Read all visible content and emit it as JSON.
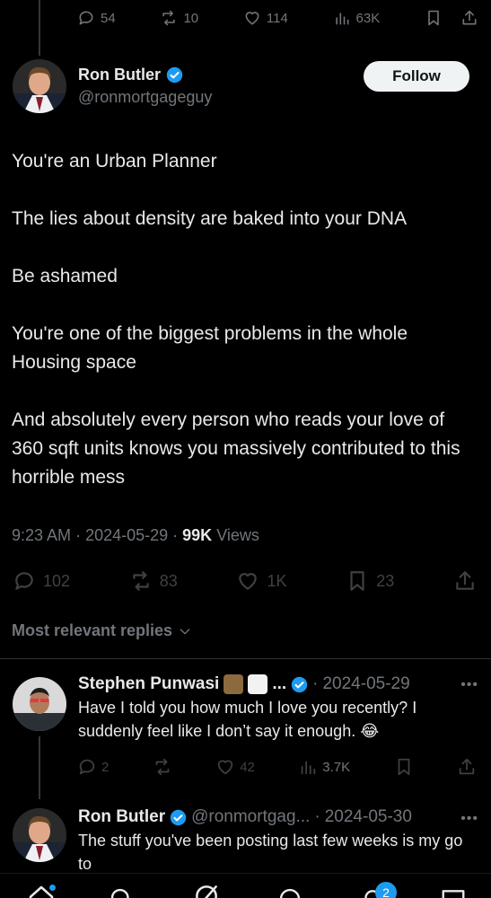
{
  "previous_tweet": {
    "actions": {
      "replies": "54",
      "reposts": "10",
      "likes": "114",
      "views": "63K"
    }
  },
  "tweet": {
    "author_name": "Ron Butler",
    "author_handle": "@ronmortgageguy",
    "follow_label": "Follow",
    "paragraphs": [
      "You're an Urban Planner",
      "The lies about density are baked into your DNA",
      "Be ashamed",
      "You're one of the biggest problems in the whole Housing space",
      "And absolutely every person who reads your love of 360 sqft units knows you massively contributed to this horrible mess"
    ],
    "time": "9:23 AM",
    "date": "2024-05-29",
    "views_count": "99K",
    "views_label": "Views",
    "actions": {
      "replies": "102",
      "reposts": "83",
      "likes": "1K",
      "bookmarks": "23"
    }
  },
  "replies_filter": "Most relevant replies",
  "replies": [
    {
      "author_name": "Stephen Punwasi",
      "name_suffix": "...",
      "date": "2024-05-29",
      "text": "Have I told you how much I love you recently? I suddenly feel like I don’t say it enough. 😂",
      "actions": {
        "replies": "2",
        "likes": "42",
        "views": "3.7K"
      }
    },
    {
      "author_name": "Ron Butler",
      "author_handle": "@ronmortgag...",
      "date": "2024-05-30",
      "text": "The stuff you've been posting last few weeks is my go to"
    }
  ],
  "bottom_nav": {
    "notifications_badge": "2"
  },
  "colors": {
    "background": "#000000",
    "text": "#e7e9ea",
    "muted": "#71767b",
    "accent": "#1d9bf0"
  }
}
